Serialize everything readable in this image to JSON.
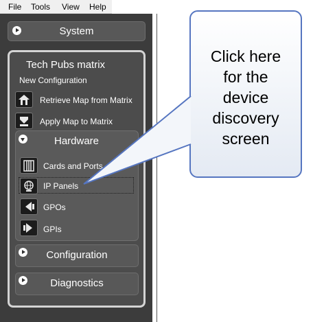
{
  "menu": {
    "items": [
      "File",
      "Tools",
      "View",
      "Help"
    ]
  },
  "sidebar": {
    "system_label": "System",
    "matrix_title": "Tech Pubs matrix",
    "matrix_subtitle": "New Configuration",
    "retrieve_label": "Retrieve Map from Matrix",
    "apply_label": "Apply Map to Matrix",
    "hardware_label": "Hardware",
    "hardware_items": [
      "Cards and Ports",
      "IP Panels",
      "GPOs",
      "GPIs"
    ],
    "configuration_label": "Configuration",
    "diagnostics_label": "Diagnostics"
  },
  "callout": {
    "lines": [
      "Click here",
      "for the",
      "device",
      "discovery",
      "screen"
    ]
  },
  "colors": {
    "panel_bg": "#3c3c3c",
    "callout_border": "#5575c0"
  }
}
